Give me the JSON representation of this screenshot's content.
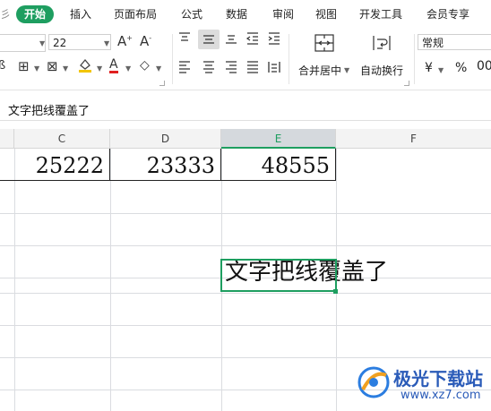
{
  "menu": {
    "active": "开始",
    "items": [
      "插入",
      "页面布局",
      "公式",
      "数据",
      "审阅",
      "视图",
      "开发工具",
      "会员专享"
    ]
  },
  "ribbon": {
    "font_size": "22",
    "merge_label": "合并居中",
    "wrap_label": "自动换行",
    "format_value": "常规",
    "currency_symbol": "¥",
    "percent_symbol": "%"
  },
  "formula_bar": {
    "content": "文字把线覆盖了"
  },
  "grid": {
    "columns": [
      "C",
      "D",
      "E",
      "F"
    ],
    "selected_column": "E",
    "row1": [
      "25222",
      "23333",
      "48555"
    ],
    "overflow_text": "文字把线覆盖了"
  },
  "watermark": {
    "brand": "极光下载站",
    "url": "www.xz7.com"
  },
  "colors": {
    "accent": "#1e9e60",
    "header_bg": "#f3f3f3",
    "grid_line": "#dadce0"
  }
}
